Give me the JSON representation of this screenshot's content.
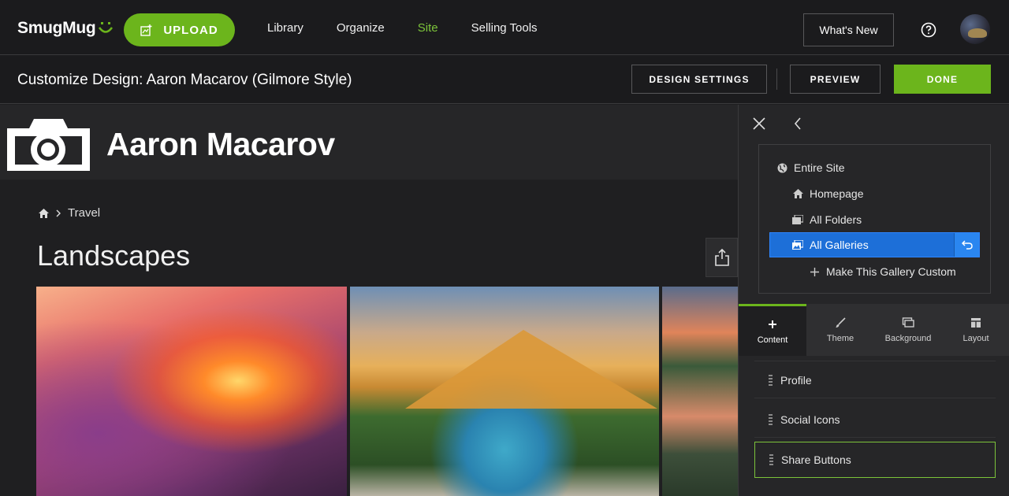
{
  "topbar": {
    "logo_text": "SmugMug",
    "upload_label": "UPLOAD",
    "nav": [
      {
        "label": "Library",
        "active": false
      },
      {
        "label": "Organize",
        "active": false
      },
      {
        "label": "Site",
        "active": true
      },
      {
        "label": "Selling Tools",
        "active": false
      }
    ],
    "whats_new_label": "What's New",
    "help_icon": "help-circle-icon",
    "accent_color": "#6cb51c"
  },
  "subbar": {
    "title": "Customize Design: Aaron Macarov (Gilmore Style)",
    "design_settings_label": "DESIGN SETTINGS",
    "preview_label": "PREVIEW",
    "done_label": "DONE"
  },
  "site": {
    "name": "Aaron Macarov",
    "breadcrumb": [
      "Travel"
    ],
    "gallery_title": "Landscapes",
    "share_icon": "share-icon"
  },
  "panel": {
    "tree": [
      {
        "label": "Entire Site",
        "icon": "globe-icon"
      },
      {
        "label": "Homepage",
        "icon": "home-icon"
      },
      {
        "label": "All Folders",
        "icon": "folders-icon"
      },
      {
        "label": "All Galleries",
        "icon": "galleries-icon",
        "selected": true
      },
      {
        "label": "Make This Gallery Custom",
        "icon": "plus-icon"
      }
    ],
    "selected_color": "#1d6fd8",
    "tabs": [
      {
        "label": "Content",
        "icon": "plus-icon",
        "active": true
      },
      {
        "label": "Theme",
        "icon": "brush-icon"
      },
      {
        "label": "Background",
        "icon": "monitor-icon"
      },
      {
        "label": "Layout",
        "icon": "layout-icon"
      }
    ],
    "content_items": [
      {
        "label": "Profile"
      },
      {
        "label": "Social Icons"
      },
      {
        "label": "Share Buttons",
        "highlight": true
      }
    ]
  }
}
